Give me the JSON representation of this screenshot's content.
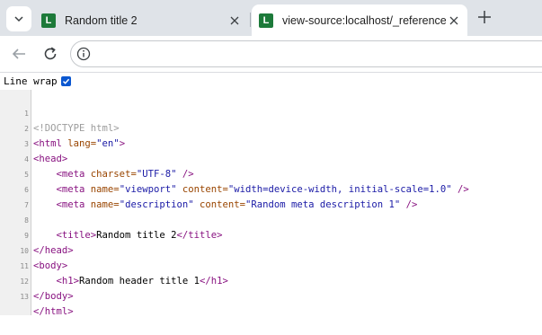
{
  "tabs": [
    {
      "favicon_letter": "L",
      "title": "Random title 2",
      "active": false
    },
    {
      "favicon_letter": "L",
      "title": "view-source:localhost/_reference/_",
      "active": true
    }
  ],
  "toolbar": {
    "url": ""
  },
  "line_wrap": {
    "label": "Line wrap",
    "checked": true
  },
  "source": {
    "line_numbers": [
      "1",
      "2",
      "3",
      "4",
      "5",
      "6",
      "7",
      "8",
      "9",
      "10",
      "11",
      "12",
      "13"
    ],
    "l1": {
      "doc": "<!DOCTYPE html>"
    },
    "l2": {
      "open": "<html ",
      "attr": "lang=",
      "val": "\"en\"",
      "close": ">"
    },
    "l3": {
      "tag": "<head>"
    },
    "l4": {
      "indent": "    ",
      "open": "<meta ",
      "attr": "charset=",
      "val": "\"UTF-8\"",
      "close": " />"
    },
    "l5": {
      "indent": "    ",
      "open": "<meta ",
      "attr1": "name=",
      "val1": "\"viewport\"",
      "attr2": " content=",
      "val2": "\"width=device-width, initial-scale=1.0\"",
      "close": " />"
    },
    "l6": {
      "indent": "    ",
      "open": "<meta ",
      "attr1": "name=",
      "val1": "\"description\"",
      "attr2": " content=",
      "val2": "\"Random meta description 1\"",
      "close": " />"
    },
    "l8": {
      "indent": "    ",
      "open": "<title>",
      "text": "Random title 2",
      "close": "</title>"
    },
    "l9": {
      "tag": "</head>"
    },
    "l10": {
      "tag": "<body>"
    },
    "l11": {
      "indent": "    ",
      "open": "<h1>",
      "text": "Random header title 1",
      "close": "</h1>"
    },
    "l12": {
      "tag": "</body>"
    },
    "l13": {
      "tag": "</html>"
    }
  }
}
